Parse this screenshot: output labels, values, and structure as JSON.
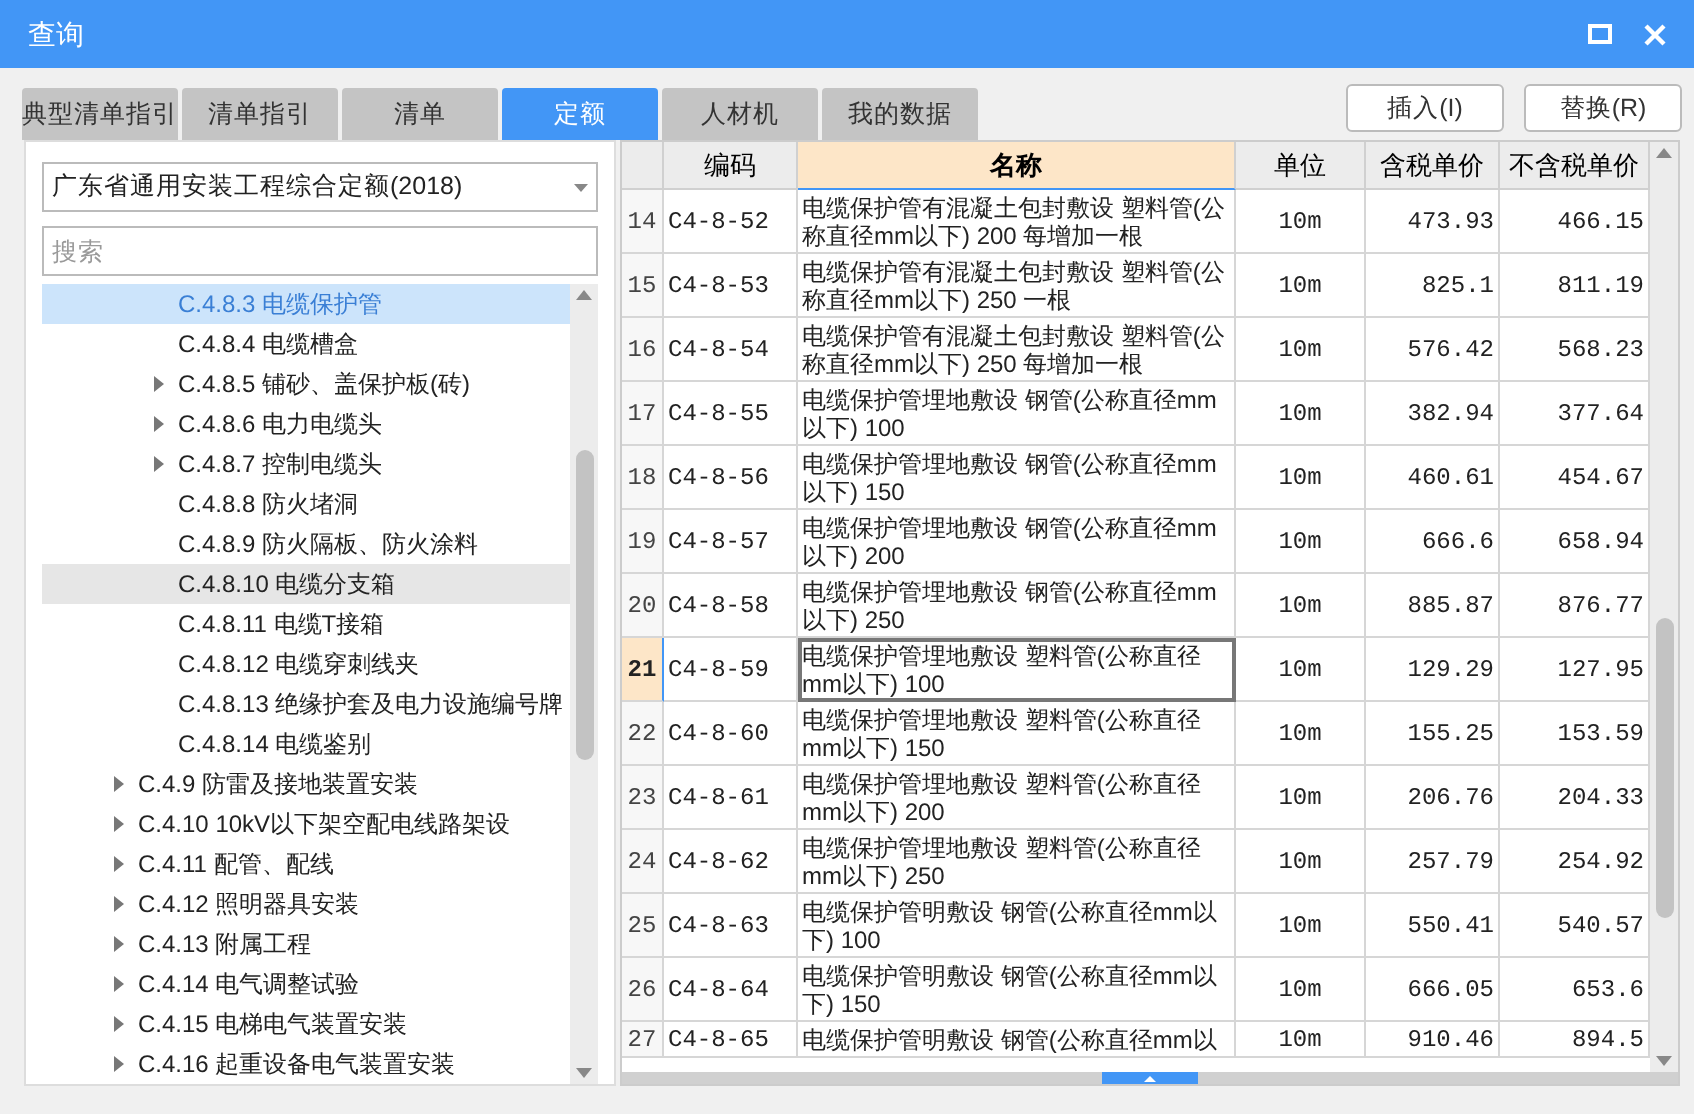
{
  "window": {
    "title": "查询"
  },
  "tabs": [
    {
      "label": "典型清单指引",
      "selected": false
    },
    {
      "label": "清单指引",
      "selected": false
    },
    {
      "label": "清单",
      "selected": false
    },
    {
      "label": "定额",
      "selected": true
    },
    {
      "label": "人材机",
      "selected": false
    },
    {
      "label": "我的数据",
      "selected": false
    }
  ],
  "buttons": [
    "插入(I)",
    "替换(R)"
  ],
  "library_select": {
    "value": "广东省通用安装工程综合定额(2018)"
  },
  "search": {
    "placeholder": "搜索"
  },
  "tree": [
    {
      "children": [
        {
          "label": "C.4.8.3 电缆保护管",
          "expandable": false,
          "selected": true,
          "hovered": false
        },
        {
          "label": "C.4.8.4 电缆槽盒",
          "expandable": false,
          "selected": false,
          "hovered": false
        },
        {
          "label": "C.4.8.5 铺砂、盖保护板(砖)",
          "expandable": true,
          "selected": false,
          "hovered": false
        },
        {
          "label": "C.4.8.6 电力电缆头",
          "expandable": true,
          "selected": false,
          "hovered": false
        },
        {
          "label": "C.4.8.7 控制电缆头",
          "expandable": true,
          "selected": false,
          "hovered": false
        },
        {
          "label": "C.4.8.8 防火堵洞",
          "expandable": false,
          "selected": false,
          "hovered": false
        },
        {
          "label": "C.4.8.9 防火隔板、防火涂料",
          "expandable": false,
          "selected": false,
          "hovered": false
        },
        {
          "label": "C.4.8.10 电缆分支箱",
          "expandable": false,
          "selected": false,
          "hovered": true
        },
        {
          "label": "C.4.8.11 电缆T接箱",
          "expandable": false,
          "selected": false,
          "hovered": false
        },
        {
          "label": "C.4.8.12 电缆穿刺线夹",
          "expandable": false,
          "selected": false,
          "hovered": false
        },
        {
          "label": "C.4.8.13 绝缘护套及电力设施编号牌",
          "expandable": false,
          "selected": false,
          "hovered": false
        },
        {
          "label": "C.4.8.14 电缆鉴别",
          "expandable": false,
          "selected": false,
          "hovered": false
        }
      ]
    },
    {
      "label": "C.4.9 防雷及接地装置安装",
      "expandable": true,
      "selected": false,
      "hovered": false
    },
    {
      "label": "C.4.10 10kV以下架空配电线路架设",
      "expandable": true,
      "selected": false,
      "hovered": false
    },
    {
      "label": "C.4.11 配管、配线",
      "expandable": true,
      "selected": false,
      "hovered": false
    },
    {
      "label": "C.4.12 照明器具安装",
      "expandable": true,
      "selected": false,
      "hovered": false
    },
    {
      "label": "C.4.13 附属工程",
      "expandable": true,
      "selected": false,
      "hovered": false
    },
    {
      "label": "C.4.14 电气调整试验",
      "expandable": true,
      "selected": false,
      "hovered": false
    },
    {
      "label": "C.4.15 电梯电气装置安装",
      "expandable": true,
      "selected": false,
      "hovered": false
    },
    {
      "label": "C.4.16 起重设备电气装置安装",
      "expandable": true,
      "selected": false,
      "hovered": false
    }
  ],
  "table": {
    "columns": [
      "",
      "编码",
      "名称",
      "单位",
      "含税单价",
      "不含税单价"
    ],
    "rows": [
      {
        "cells": [
          "14",
          "C4-8-52",
          "电缆保护管有混凝土包封敷设 塑料管(公称直径mm以下) 200 每增加一根",
          "10m",
          "473.93",
          "466.15"
        ],
        "selected": false
      },
      {
        "cells": [
          "15",
          "C4-8-53",
          "电缆保护管有混凝土包封敷设 塑料管(公称直径mm以下) 250 一根",
          "10m",
          "825.1",
          "811.19"
        ],
        "selected": false
      },
      {
        "cells": [
          "16",
          "C4-8-54",
          "电缆保护管有混凝土包封敷设 塑料管(公称直径mm以下) 250 每增加一根",
          "10m",
          "576.42",
          "568.23"
        ],
        "selected": false
      },
      {
        "cells": [
          "17",
          "C4-8-55",
          "电缆保护管埋地敷设 钢管(公称直径mm以下) 100",
          "10m",
          "382.94",
          "377.64"
        ],
        "selected": false
      },
      {
        "cells": [
          "18",
          "C4-8-56",
          "电缆保护管埋地敷设 钢管(公称直径mm以下) 150",
          "10m",
          "460.61",
          "454.67"
        ],
        "selected": false
      },
      {
        "cells": [
          "19",
          "C4-8-57",
          "电缆保护管埋地敷设 钢管(公称直径mm以下) 200",
          "10m",
          "666.6",
          "658.94"
        ],
        "selected": false
      },
      {
        "cells": [
          "20",
          "C4-8-58",
          "电缆保护管埋地敷设 钢管(公称直径mm以下) 250",
          "10m",
          "885.87",
          "876.77"
        ],
        "selected": false
      },
      {
        "cells": [
          "21",
          "C4-8-59",
          "电缆保护管埋地敷设 塑料管(公称直径mm以下) 100",
          "10m",
          "129.29",
          "127.95"
        ],
        "selected": true
      },
      {
        "cells": [
          "22",
          "C4-8-60",
          "电缆保护管埋地敷设 塑料管(公称直径mm以下) 150",
          "10m",
          "155.25",
          "153.59"
        ],
        "selected": false
      },
      {
        "cells": [
          "23",
          "C4-8-61",
          "电缆保护管埋地敷设 塑料管(公称直径mm以下) 200",
          "10m",
          "206.76",
          "204.33"
        ],
        "selected": false
      },
      {
        "cells": [
          "24",
          "C4-8-62",
          "电缆保护管埋地敷设 塑料管(公称直径mm以下) 250",
          "10m",
          "257.79",
          "254.92"
        ],
        "selected": false
      },
      {
        "cells": [
          "25",
          "C4-8-63",
          "电缆保护管明敷设 钢管(公称直径mm以下) 100",
          "10m",
          "550.41",
          "540.57"
        ],
        "selected": false
      },
      {
        "cells": [
          "26",
          "C4-8-64",
          "电缆保护管明敷设 钢管(公称直径mm以下) 150",
          "10m",
          "666.05",
          "653.6"
        ],
        "selected": false
      },
      {
        "cells": [
          "27",
          "C4-8-65",
          "电缆保护管明敷设 钢管(公称直径mm以",
          "10m",
          "910.46",
          "894.5"
        ],
        "selected": false
      }
    ]
  }
}
